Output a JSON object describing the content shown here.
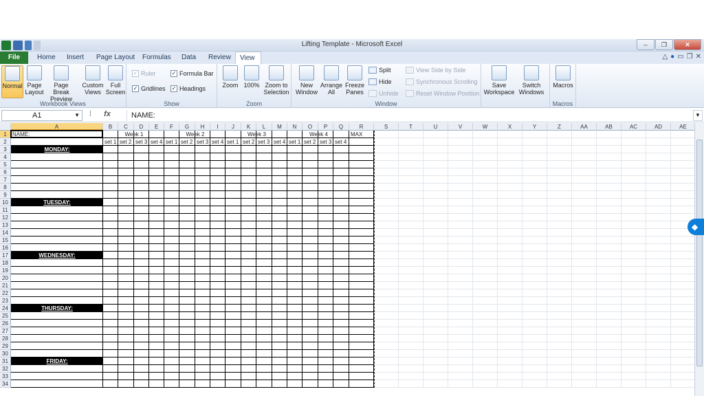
{
  "window": {
    "title": "Lifting Template - Microsoft Excel",
    "buttons": [
      "–",
      "❐",
      "✕"
    ]
  },
  "tabs": [
    "File",
    "Home",
    "Insert",
    "Page Layout",
    "Formulas",
    "Data",
    "Review",
    "View"
  ],
  "active_tab": "View",
  "ribbon": {
    "workbook_views": {
      "label": "Workbook Views",
      "normal": "Normal",
      "page_layout": "Page Layout",
      "page_break": "Page Break Preview",
      "custom": "Custom Views",
      "full": "Full Screen"
    },
    "show": {
      "label": "Show",
      "ruler": "Ruler",
      "gridlines": "Gridlines",
      "formula_bar": "Formula Bar",
      "headings": "Headings"
    },
    "zoom": {
      "label": "Zoom",
      "zoom": "Zoom",
      "hundred": "100%",
      "selection": "Zoom to Selection"
    },
    "window": {
      "label": "Window",
      "new": "New Window",
      "arrange": "Arrange All",
      "freeze": "Freeze Panes",
      "split": "Split",
      "hide": "Hide",
      "unhide": "Unhide",
      "side": "View Side by Side",
      "sync": "Synchronous Scrolling",
      "reset": "Reset Window Position",
      "save": "Save Workspace",
      "switch": "Switch Windows"
    },
    "macros": {
      "label": "Macros",
      "macros": "Macros"
    }
  },
  "formula_bar": {
    "name_box": "A1",
    "fx": "fx",
    "value": "NAME:"
  },
  "columns": [
    "A",
    "B",
    "C",
    "D",
    "E",
    "F",
    "G",
    "H",
    "I",
    "J",
    "K",
    "L",
    "M",
    "N",
    "O",
    "P",
    "Q",
    "R",
    "S",
    "T",
    "U",
    "V",
    "W",
    "X",
    "Y",
    "Z",
    "AA",
    "AB",
    "AC",
    "AD",
    "AE"
  ],
  "rows": [
    "1",
    "2",
    "3",
    "4",
    "5",
    "6",
    "7",
    "8",
    "9",
    "10",
    "11",
    "12",
    "13",
    "14",
    "15",
    "16",
    "17",
    "18",
    "19",
    "20",
    "21",
    "22",
    "23",
    "24",
    "25",
    "26",
    "27",
    "28",
    "29",
    "30",
    "31",
    "32",
    "33",
    "34"
  ],
  "sheet": {
    "name_label": "NAME:",
    "weeks": [
      "Week 1",
      "Week 2",
      "Week 3",
      "Week 4"
    ],
    "max": "MAX",
    "sets": [
      "set 1",
      "set 2",
      "set 3",
      "set 4",
      "set 1",
      "set 2",
      "set 3",
      "set 4",
      "set 1",
      "set 2",
      "set 3",
      "set 4",
      "set 1",
      "set 2",
      "set 3",
      "set 4"
    ],
    "days": [
      {
        "row": 3,
        "label": "MONDAY:"
      },
      {
        "row": 10,
        "label": "TUESDAY:"
      },
      {
        "row": 17,
        "label": "WEDNESDAY:"
      },
      {
        "row": 24,
        "label": "THURSDAY:"
      },
      {
        "row": 31,
        "label": "FRIDAY:"
      }
    ]
  }
}
